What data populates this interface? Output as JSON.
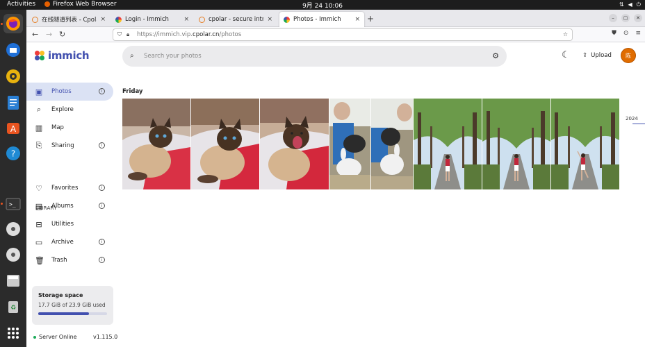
{
  "system": {
    "activities": "Activities",
    "app_name": "Firefox Web Browser",
    "clock": "9月 24  10:06"
  },
  "browser": {
    "tabs": [
      {
        "label": "在线隧道列表 - Cpolar",
        "close": "×"
      },
      {
        "label": "Login - Immich",
        "close": "×"
      },
      {
        "label": "cpolar - secure introspect",
        "close": "×"
      },
      {
        "label": "Photos - Immich",
        "close": "×"
      }
    ],
    "new_tab": "+",
    "url_prefix": "https://immich.vip.",
    "url_domain": "cpolar.cn",
    "url_path": "/photos"
  },
  "app": {
    "logo_text": "immich",
    "search_placeholder": "Search your photos",
    "upload_label": "Upload",
    "avatar_initial": "陈",
    "nav": [
      {
        "label": "Photos",
        "icon": "photos-icon"
      },
      {
        "label": "Explore",
        "icon": "search-icon"
      },
      {
        "label": "Map",
        "icon": "map-icon"
      },
      {
        "label": "Sharing",
        "icon": "sharing-icon"
      }
    ],
    "library_heading": "LIBRARY",
    "library": [
      {
        "label": "Favorites",
        "icon": "heart-icon"
      },
      {
        "label": "Albums",
        "icon": "albums-icon"
      },
      {
        "label": "Utilities",
        "icon": "toolbox-icon"
      },
      {
        "label": "Archive",
        "icon": "archive-icon"
      },
      {
        "label": "Trash",
        "icon": "trash-icon"
      }
    ],
    "storage_title": "Storage space",
    "storage_usage": "17.7 GiB of 23.9 GiB used",
    "storage_used_fraction": 0.74,
    "server_status": "Server Online",
    "version": "v1.115.0"
  },
  "timeline": {
    "day_label": "Friday",
    "year_label": "2024",
    "photos": [
      {
        "subject": "siamese-cat"
      },
      {
        "subject": "siamese-cat"
      },
      {
        "subject": "siamese-cat-yawning"
      },
      {
        "subject": "rabbits"
      },
      {
        "subject": "rabbits"
      },
      {
        "subject": "girl-on-tree-lined-path"
      },
      {
        "subject": "girl-on-tree-lined-path"
      },
      {
        "subject": "girl-on-tree-lined-path"
      }
    ]
  },
  "colors": {
    "accent": "#4250af",
    "sidebar_active_bg": "#dbe2f4",
    "avatar": "#e06c00"
  }
}
